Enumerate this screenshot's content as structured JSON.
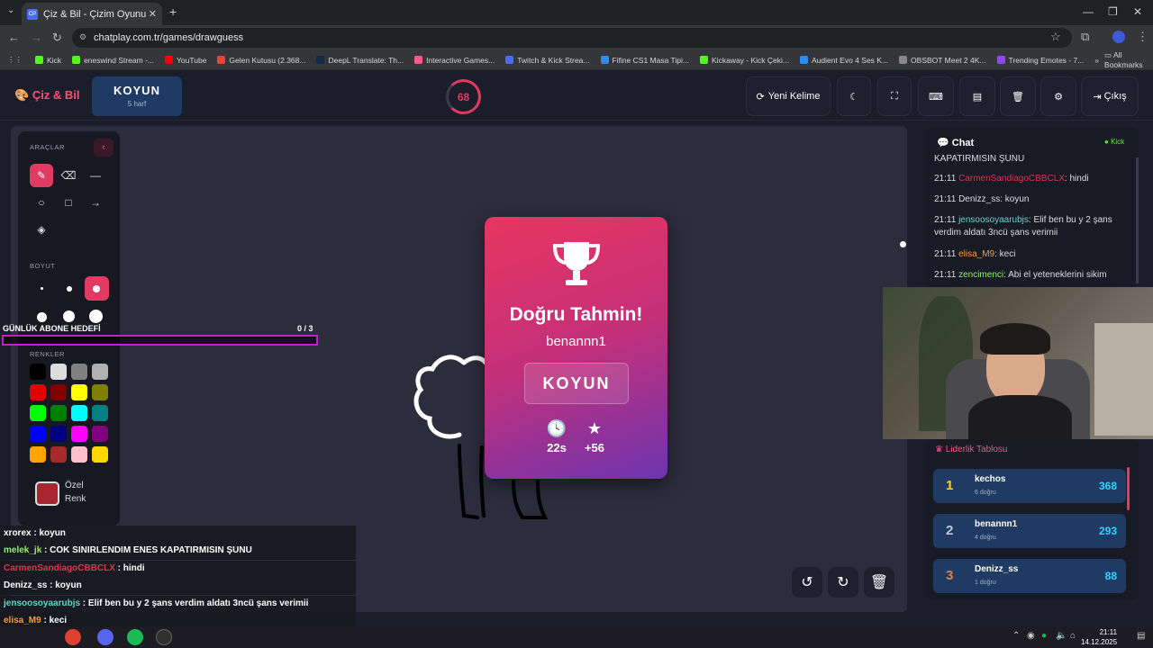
{
  "browser": {
    "tab_title": "Çiz & Bil - Çizim Oyunu",
    "tab_favicon": "CP",
    "url": "chatplay.com.tr/games/drawguess",
    "bookmarks": [
      {
        "label": "Kick",
        "color": "#53fc18"
      },
      {
        "label": "eneswind Stream -...",
        "color": "#53fc18"
      },
      {
        "label": "YouTube",
        "color": "#ff0000"
      },
      {
        "label": "Gelen Kutusu (2.368...",
        "color": "#ea4335"
      },
      {
        "label": "DeepL Translate: Th...",
        "color": "#0f2b46"
      },
      {
        "label": "Interactive Games...",
        "color": "#ff5a8a"
      },
      {
        "label": "Twitch & Kick Strea...",
        "color": "#4a6cf7"
      },
      {
        "label": "Fifine CS1 Masa Tipi...",
        "color": "#2d8cf0"
      },
      {
        "label": "Kickaway - Kick Çeki...",
        "color": "#53fc18"
      },
      {
        "label": "Audient Evo 4 Ses K...",
        "color": "#2d8cf0"
      },
      {
        "label": "OBSBOT Meet 2 4K...",
        "color": "#888888"
      },
      {
        "label": "Trending Emotes - 7...",
        "color": "#9146ff"
      }
    ],
    "all_bookmarks": "All Bookmarks"
  },
  "header": {
    "brand": "Çiz & Bil",
    "word": "KOYUN",
    "word_hint": "5 harf",
    "timer": "68",
    "new_word": "Yeni Kelime",
    "exit": "Çıkış"
  },
  "tools": {
    "tools_title": "ARAÇLAR",
    "size_title": "BOYUT",
    "colors_title": "RENKLER",
    "custom_label": "Özel Renk",
    "colors": [
      "#000000",
      "#dddddd",
      "#808080",
      "#b0b0b0",
      "#e00000",
      "#800000",
      "#ffff00",
      "#808000",
      "#00ff00",
      "#008000",
      "#00ffff",
      "#008080",
      "#0000ff",
      "#000080",
      "#ff00ff",
      "#800080",
      "#ffa500",
      "#a52a2a",
      "#ffc0cb",
      "#ffd700"
    ]
  },
  "goal": {
    "label": "GÜNLÜK ABONE HEDEFİ",
    "count": "0  / 3"
  },
  "modal": {
    "title": "Doğru Tahmin!",
    "winner": "benannn1",
    "word": "KOYUN",
    "time": "22s",
    "points": "+56"
  },
  "chat": {
    "title": "Chat",
    "platform": "Kick",
    "cut_message": "KAPATIRMISIN ŞUNU",
    "messages": [
      {
        "time": "21:11",
        "user": "CarmenSandiagoCBBCLX",
        "color": "#e0334e",
        "text": ": hindi"
      },
      {
        "time": "21:11",
        "user": "Denizz_ss",
        "color": "#dddddd",
        "text": ": koyun"
      },
      {
        "time": "21:11",
        "user": "jensoosoyaarubjs",
        "color": "#5ed6c8",
        "text": ": Elif ben bu y 2 şans verdim aldatı 3ncü şans verimii"
      },
      {
        "time": "21:11",
        "user": "elisa_M9",
        "color": "#f0a040",
        "text": ": keci"
      },
      {
        "time": "21:11",
        "user": "zencimenci",
        "color": "#8ef070",
        "text": ": Abi el yeteneklerini sikim"
      }
    ]
  },
  "leaderboard": {
    "title": "Liderlik Tablosu",
    "rows": [
      {
        "rank": "1",
        "name": "kechos",
        "sub": "6 doğru",
        "score": "368",
        "rank_color": "#ffd700"
      },
      {
        "rank": "2",
        "name": "benannn1",
        "sub": "4 doğru",
        "score": "293",
        "rank_color": "#c0c8d8"
      },
      {
        "rank": "3",
        "name": "Denizz_ss",
        "sub": "1 doğru",
        "score": "88",
        "rank_color": "#e08040"
      }
    ]
  },
  "overlay_chat": [
    {
      "user": "xrorex",
      "color": "#ffffff",
      "text": " : koyun"
    },
    {
      "user": "melek_jk",
      "color": "#8ef070",
      "text": " : COK SINIRLENDIM ENES KAPATIRMISIN ŞUNU"
    },
    {
      "user": "CarmenSandiagoCBBCLX",
      "color": "#e0334e",
      "text": " : hindi"
    },
    {
      "user": "Denizz_ss",
      "color": "#ffffff",
      "text": " : koyun"
    },
    {
      "user": "jensoosoyaarubjs",
      "color": "#5ed6c8",
      "text": " : Elif ben bu y 2 şans verdim aldatı 3ncü şans verimii"
    },
    {
      "user": "elisa_M9",
      "color": "#f0a040",
      "text": " : keci"
    },
    {
      "user": "zencimenci",
      "color": "#8ef070",
      "text": " : Abi el yeteneklerini sikim"
    }
  ],
  "taskbar": {
    "time": "21:11",
    "date": "14.12.2025"
  }
}
